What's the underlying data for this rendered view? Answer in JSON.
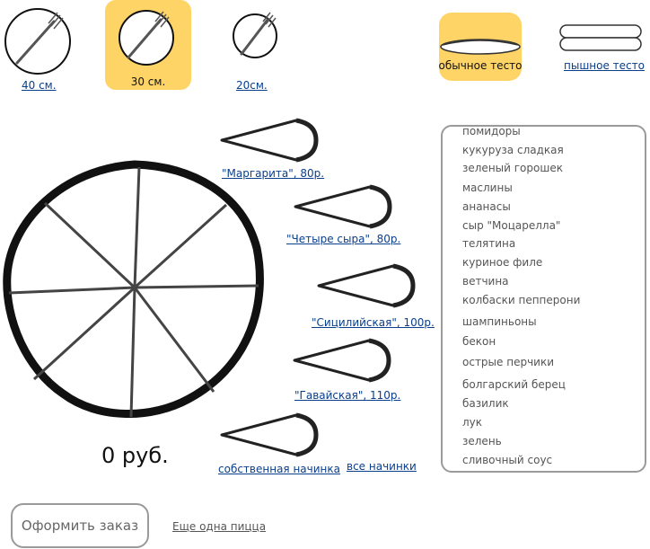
{
  "sizes": [
    {
      "label": "40 см.",
      "selected": false
    },
    {
      "label": "30 см.",
      "selected": true
    },
    {
      "label": "20см.",
      "selected": false
    }
  ],
  "dough": {
    "regular_label": "обычное тесто",
    "fluffy_label": "пышное тесто",
    "selected": "regular"
  },
  "slices": [
    {
      "label": "\"Маргарита\", 80р."
    },
    {
      "label": "\"Четыре сыра\", 80р."
    },
    {
      "label": "\"Сицилийская\", 100р."
    },
    {
      "label": "\"Гавайская\", 110р."
    },
    {
      "label": "собственная начинка"
    }
  ],
  "all_fillings_link": "все начинки",
  "price": "0 руб.",
  "ingredients": [
    "помидоры",
    "кукуруза сладкая",
    "зеленый горошек",
    "маслины",
    "ананасы",
    "сыр \"Моцарелла\"",
    "телятина",
    "куриное филе",
    "ветчина",
    "колбаски пепперони",
    "шампиньоны",
    "бекон",
    "острые перчики",
    "болгарский берец",
    "базилик",
    "лук",
    "зелень",
    "сливочный соус"
  ],
  "order_button": "Оформить заказ",
  "another_pizza_link": "Еще одна пицца",
  "colors": {
    "highlight": "#ffd467",
    "link": "#0a3f8c"
  },
  "icons": {
    "size_option": "plate-fork-icon",
    "dough_option": "dough-icon",
    "slice": "pizza-slice-icon"
  }
}
